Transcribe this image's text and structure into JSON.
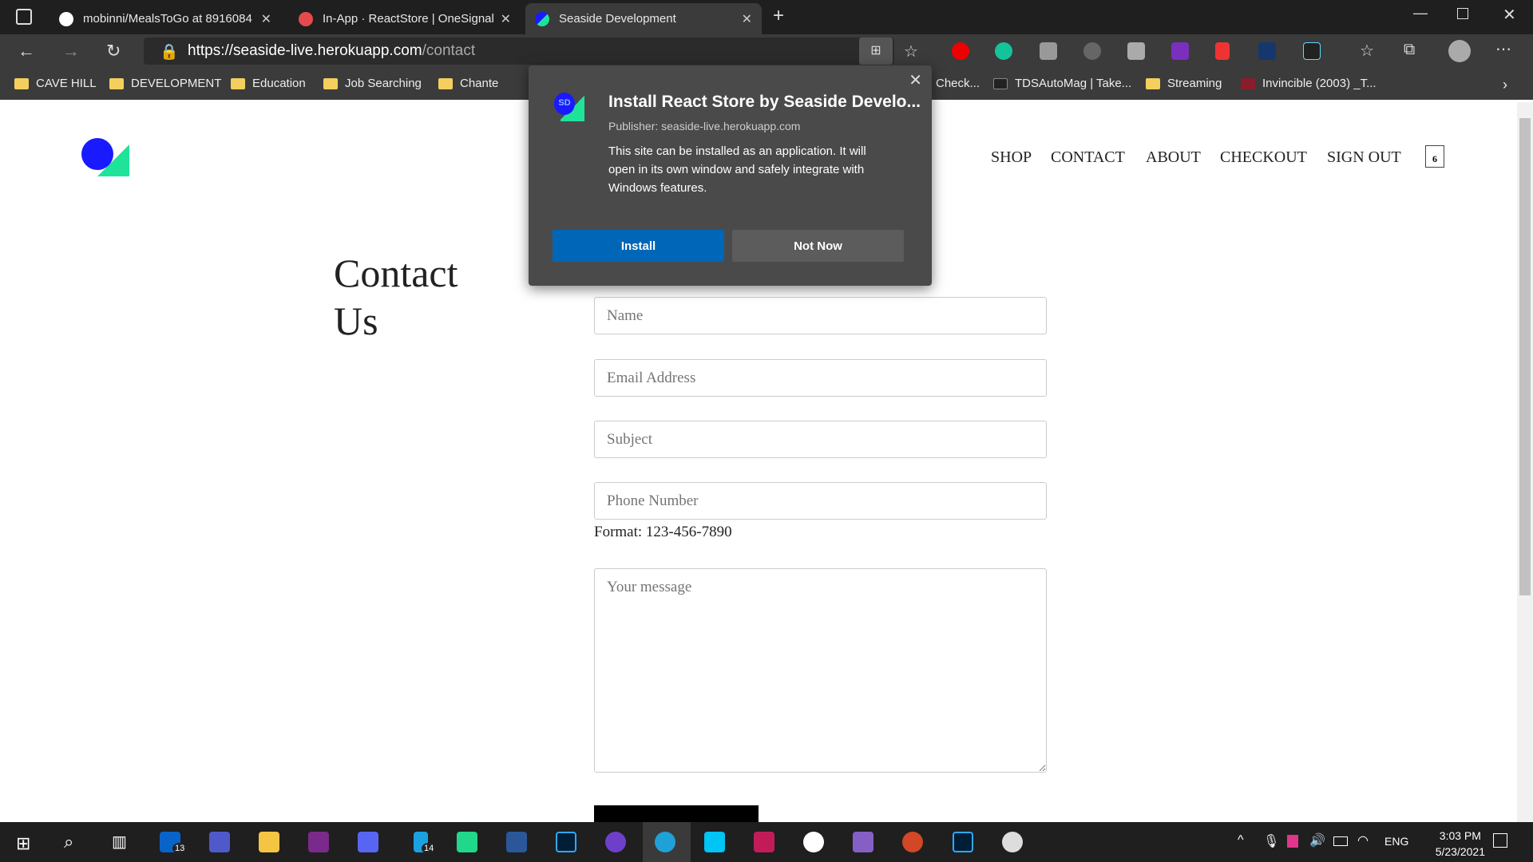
{
  "browser": {
    "tabs": [
      {
        "label": "mobinni/MealsToGo at 8916084",
        "active": false,
        "color": "#ffffff"
      },
      {
        "label": "In-App · ReactStore | OneSignal",
        "active": false,
        "color": "#e54b4d"
      },
      {
        "label": "Seaside Development",
        "active": true,
        "color": "#1a1aff"
      }
    ],
    "url_host": "https://seaside-live.herokuapp.com",
    "url_path": "/contact",
    "bookmarks": [
      "CAVE HILL",
      "DEVELOPMENT",
      "Education",
      "Job Searching",
      "Chante",
      "Check...",
      "TDSAutoMag | Take...",
      "Streaming",
      "Invincible (2003) _T..."
    ]
  },
  "popup": {
    "title": "Install React Store by Seaside Develo...",
    "publisher": "Publisher: seaside-live.herokuapp.com",
    "description": "This site can be installed as an application. It will open in its own window and safely integrate with Windows features.",
    "install": "Install",
    "not_now": "Not Now",
    "icon_text": "SD"
  },
  "site": {
    "nav": [
      "SHOP",
      "CONTACT",
      "ABOUT",
      "CHECKOUT",
      "SIGN OUT"
    ],
    "cart_count": "6",
    "title": "Contact Us",
    "fields": {
      "name": "Name",
      "email": "Email Address",
      "subject": "Subject",
      "phone": "Phone Number",
      "message": "Your message"
    },
    "phone_format": "Format: 123-456-7890"
  },
  "taskbar": {
    "mail_badge": "13",
    "files_badge": "14",
    "time": "3:03 PM",
    "date": "5/23/2021",
    "lang": "ENG"
  }
}
